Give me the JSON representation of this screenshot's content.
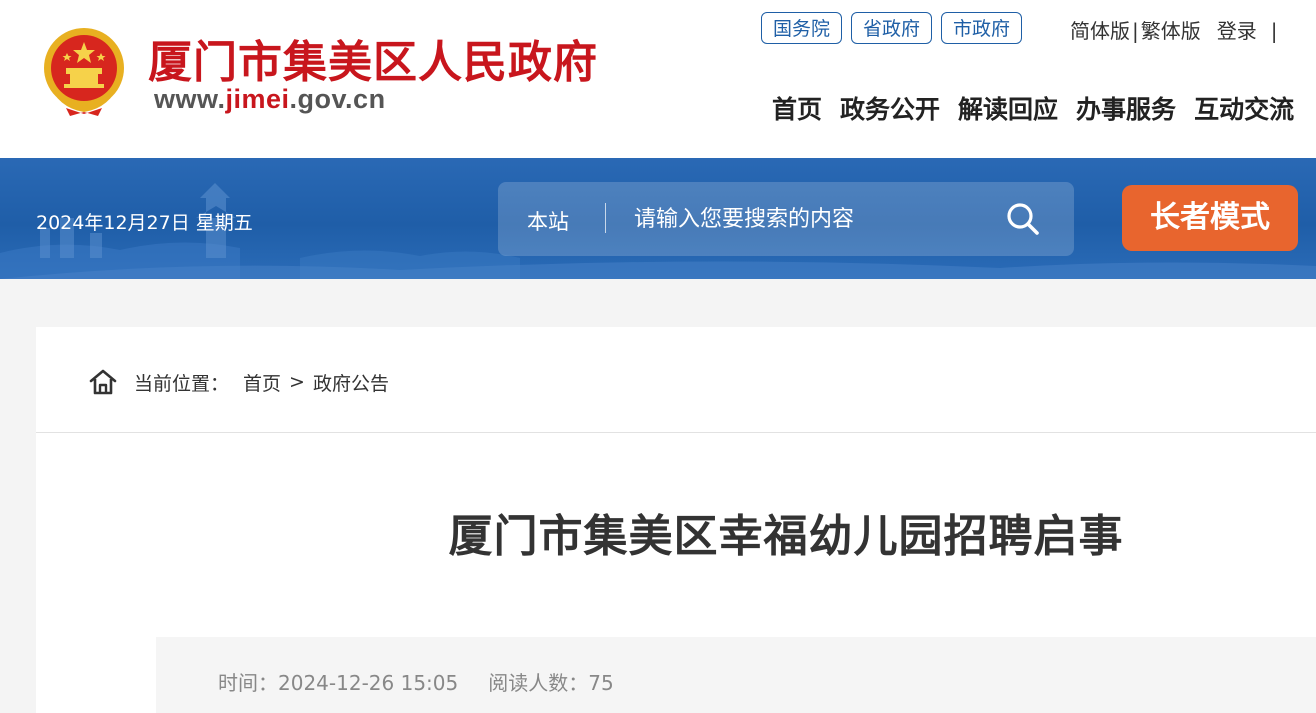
{
  "header": {
    "site_name": "厦门市集美区人民政府",
    "site_url_prefix": "www.",
    "site_url_highlight": "jimei",
    "site_url_suffix": ".gov.cn",
    "gov_links": [
      "国务院",
      "省政府",
      "市政府"
    ],
    "lang_simplified": "简体版",
    "lang_separator": "|",
    "lang_traditional": "繁体版",
    "login": "登录",
    "trailing_separator": "|",
    "nav": [
      "首页",
      "政务公开",
      "解读回应",
      "办事服务",
      "互动交流"
    ]
  },
  "banner": {
    "date": "2024年12月27日 星期五",
    "search_scope": "本站",
    "search_placeholder": "请输入您要搜索的内容",
    "elder_mode": "长者模式"
  },
  "breadcrumb": {
    "label": "当前位置：",
    "items": [
      "首页",
      "政府公告"
    ],
    "separator": ">"
  },
  "article": {
    "title": "厦门市集美区幸福幼儿园招聘启事",
    "time_label": "时间：",
    "time": "2024-12-26 15:05",
    "reads_label": "阅读人数：",
    "reads": "75"
  },
  "colors": {
    "brand_red": "#c8161d",
    "banner_blue": "#1f5ea8",
    "elder_orange": "#e8652e",
    "link_blue": "#1f5fa6"
  },
  "icons": [
    "national-emblem-icon",
    "search-icon",
    "home-icon"
  ]
}
